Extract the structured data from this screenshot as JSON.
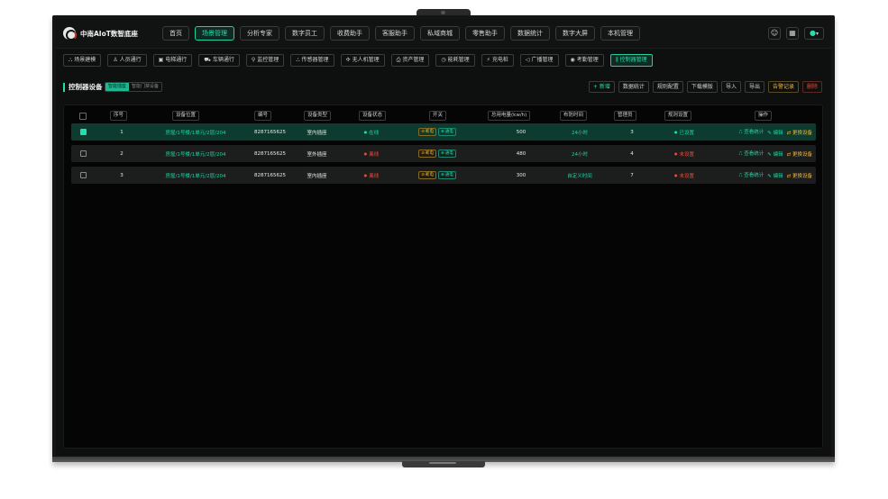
{
  "app": {
    "brand": "中南AIoT数智底座"
  },
  "topnav": [
    {
      "label": "首页",
      "active": false
    },
    {
      "label": "场景管理",
      "active": true
    },
    {
      "label": "分析专家",
      "active": false
    },
    {
      "label": "数字员工",
      "active": false
    },
    {
      "label": "收费助手",
      "active": false
    },
    {
      "label": "客服助手",
      "active": false
    },
    {
      "label": "私域商城",
      "active": false
    },
    {
      "label": "零售助手",
      "active": false
    },
    {
      "label": "数据统计",
      "active": false
    },
    {
      "label": "数字大屏",
      "active": false
    },
    {
      "label": "本机管理",
      "active": false
    }
  ],
  "subnav": [
    {
      "label": "场景建模",
      "icon": "model-icon",
      "glyph": "⛬",
      "active": false
    },
    {
      "label": "人员通行",
      "icon": "person-icon",
      "glyph": "♙",
      "active": false
    },
    {
      "label": "电梯通行",
      "icon": "elevator-icon",
      "glyph": "▣",
      "active": false
    },
    {
      "label": "车辆通行",
      "icon": "car-icon",
      "glyph": "⛟",
      "active": false
    },
    {
      "label": "监控管理",
      "icon": "location-icon",
      "glyph": "⚲",
      "active": false
    },
    {
      "label": "传感器管理",
      "icon": "sensor-icon",
      "glyph": "⛬",
      "active": false
    },
    {
      "label": "无人机管理",
      "icon": "drone-icon",
      "glyph": "✣",
      "active": false
    },
    {
      "label": "资产管理",
      "icon": "asset-icon",
      "glyph": "⎙",
      "active": false
    },
    {
      "label": "能耗管理",
      "icon": "energy-icon",
      "glyph": "◷",
      "active": false
    },
    {
      "label": "充电桩",
      "icon": "charger-icon",
      "glyph": "⚡",
      "active": false
    },
    {
      "label": "广播管理",
      "icon": "broadcast-icon",
      "glyph": "◁",
      "active": false
    },
    {
      "label": "考勤管理",
      "icon": "attendance-icon",
      "glyph": "◉",
      "active": false
    },
    {
      "label": "控制器管理",
      "icon": "controller-icon",
      "glyph": "⫼",
      "active": true
    }
  ],
  "section": {
    "title": "控制器设备",
    "tabs": [
      {
        "label": "智能插座",
        "active": true
      },
      {
        "label": "智能门禁设备",
        "active": false
      }
    ],
    "actions": {
      "add": "新增",
      "stats": "数据统计",
      "rules": "规则配置",
      "download": "下载模版",
      "import": "导入",
      "export": "导出",
      "alarm": "告警记录",
      "delete": "删除"
    }
  },
  "table": {
    "headers": {
      "index": "序号",
      "location": "设备位置",
      "code": "编号",
      "type": "设备类型",
      "status": "设备状态",
      "switch": "开关",
      "power": "总用电量(kw/h)",
      "schedule": "布防时间",
      "manager": "管理员",
      "rule": "规则设置",
      "ops": "操作"
    },
    "switch_labels": {
      "off": "断电",
      "on": "通电"
    },
    "op_labels": {
      "stats": "查看统计",
      "edit": "编辑",
      "replace": "更换设备"
    },
    "rows": [
      {
        "selected": true,
        "index": "1",
        "location": "房屋/1号楼/1单元/2层/204",
        "code": "8287165625",
        "type": "室内插座",
        "status": "在线",
        "online": true,
        "power": "500",
        "schedule": "24小时",
        "manager": "3",
        "rule": "已设置",
        "rule_set": true
      },
      {
        "selected": false,
        "index": "2",
        "location": "房屋/1号楼/1单元/2层/204",
        "code": "8287165625",
        "type": "室外插座",
        "status": "离线",
        "online": false,
        "power": "480",
        "schedule": "24小时",
        "manager": "4",
        "rule": "未设置",
        "rule_set": false
      },
      {
        "selected": false,
        "index": "3",
        "location": "房屋/1号楼/1单元/2层/204",
        "code": "8287165625",
        "type": "室内插座",
        "status": "离线",
        "online": false,
        "power": "300",
        "schedule": "自定义时间",
        "manager": "7",
        "rule": "未设置",
        "rule_set": false
      }
    ]
  },
  "colors": {
    "accent": "#1fe0ae",
    "warning": "#f2b233",
    "danger": "#e64b3c",
    "background": "#0e0f0f"
  }
}
